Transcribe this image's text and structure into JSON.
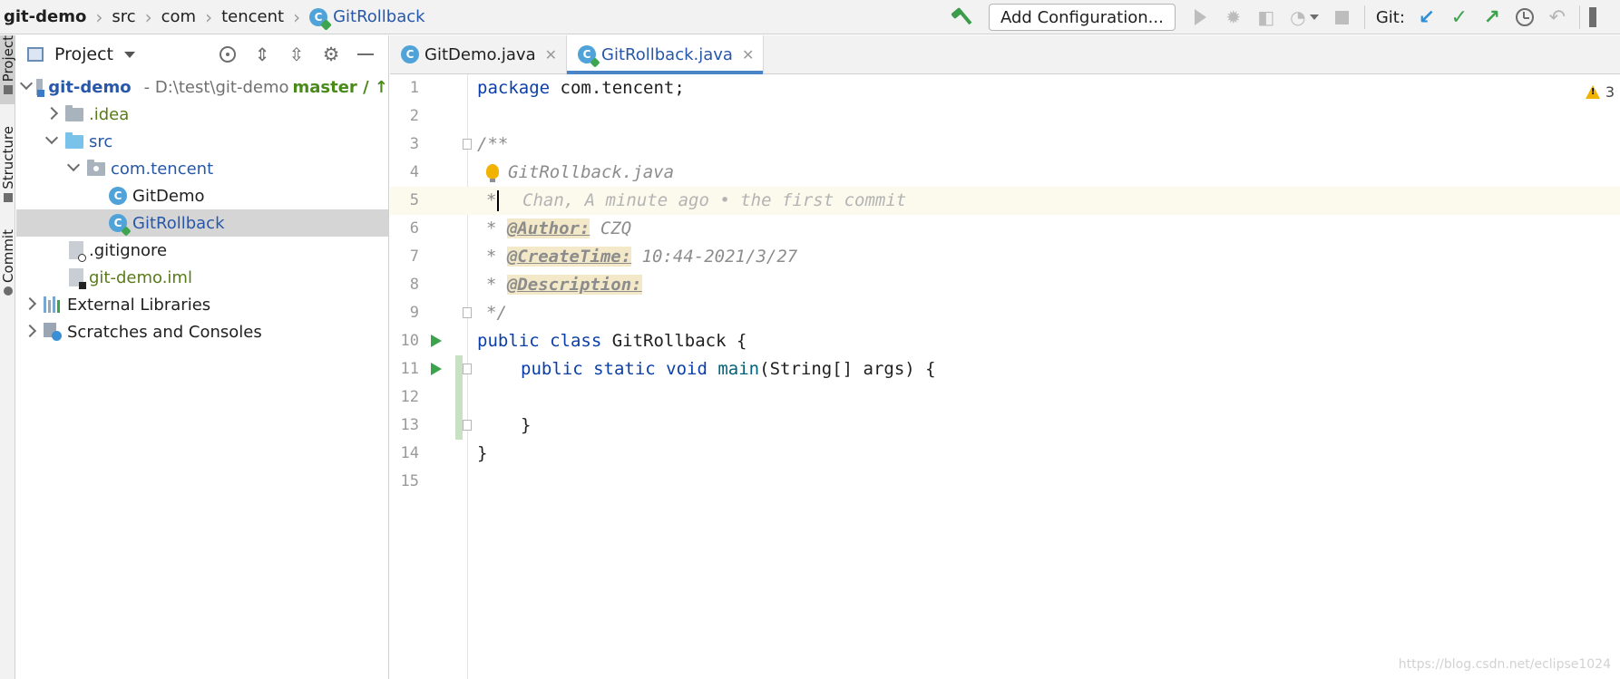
{
  "breadcrumbs": [
    {
      "label": "git-demo"
    },
    {
      "label": "src"
    },
    {
      "label": "com"
    },
    {
      "label": "tencent"
    },
    {
      "label": "GitRollback"
    }
  ],
  "toolbar": {
    "add_config_label": "Add Configuration...",
    "git_label": "Git:",
    "icons": [
      "hammer-icon",
      "run-icon",
      "debug-icon",
      "coverage-icon",
      "profile-icon",
      "stop-icon",
      "git-update-icon",
      "git-commit-icon",
      "git-push-icon",
      "git-history-icon",
      "git-rollback-icon"
    ]
  },
  "side_tabs": {
    "project": "Project",
    "structure": "Structure",
    "commit": "Commit"
  },
  "project_panel": {
    "title": "Project",
    "tree": {
      "root_name": "git-demo",
      "root_path": "- D:\\test\\git-demo",
      "root_branch": "master / ↑",
      "idea": ".idea",
      "src": "src",
      "package": "com.tencent",
      "class1": "GitDemo",
      "class2": "GitRollback",
      "gitignore": ".gitignore",
      "iml": "git-demo.iml",
      "ext_libs": "External Libraries",
      "scratches": "Scratches and Consoles"
    }
  },
  "editor": {
    "tabs": [
      {
        "label": "GitDemo.java",
        "active": false
      },
      {
        "label": "GitRollback.java",
        "active": true
      }
    ],
    "warning_count": "3",
    "current_line": 5,
    "blame_annotation": "Chan, A minute ago • the first commit",
    "line_numbers": [
      "1",
      "2",
      "3",
      "4",
      "5",
      "6",
      "7",
      "8",
      "9",
      "10",
      "11",
      "12",
      "13",
      "14",
      "15"
    ],
    "lines": {
      "l1_kw": "package",
      "l1_rest": " com.tencent;",
      "l3": "/**",
      "l4": "GitRollback.java",
      "l5": "*",
      "l6_star": "* ",
      "l6_tag": "@Author:",
      "l6_val": " CZQ",
      "l7_star": "* ",
      "l7_tag": "@CreateTime:",
      "l7_val": " 10:44-2021/3/27",
      "l8_star": "* ",
      "l8_tag": "@Description:",
      "l9": "*/",
      "l10_kw": "public class",
      "l10_rest": " GitRollback {",
      "l11_kw": "public static void",
      "l11_method": "main",
      "l11_rest": "(String[] args) {",
      "l13": "}",
      "l14": "}"
    }
  },
  "watermark": "https://blog.csdn.net/eclipse1024"
}
